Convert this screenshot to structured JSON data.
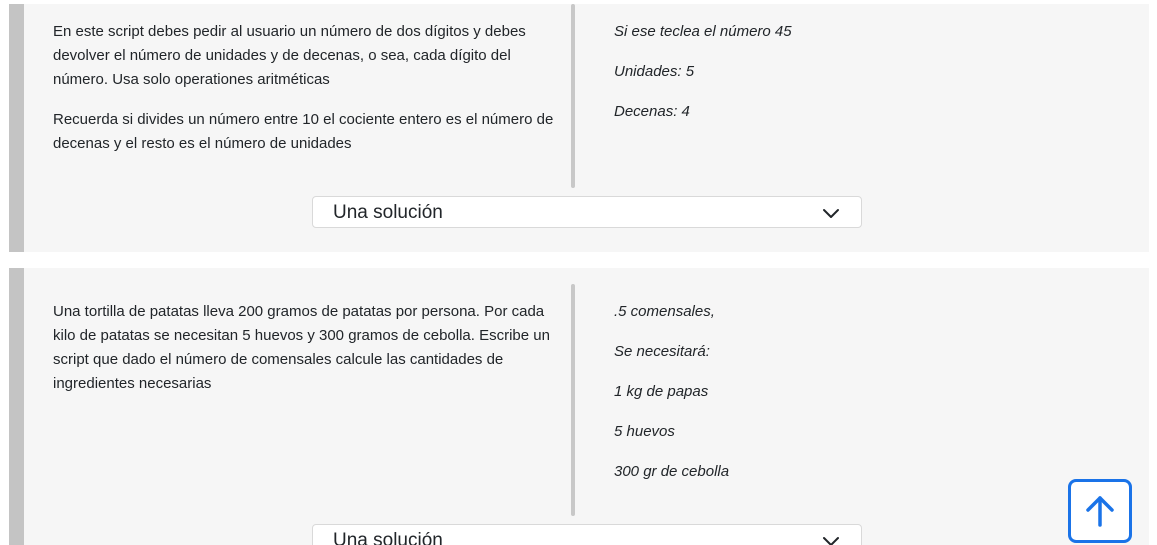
{
  "exercises": [
    {
      "statement": [
        "En este script debes pedir al usuario un número de dos dígitos y debes devolver el número de unidades y de decenas, o sea, cada dígito del número. Usa solo operationes aritméticas",
        "Recuerda si divides un número entre 10 el cociente entero es el número de decenas y el resto es el número de unidades"
      ],
      "example": [
        "Si ese teclea el número 45",
        "Unidades: 5",
        "Decenas: 4"
      ],
      "solution_label": "Una solución"
    },
    {
      "statement": [
        "Una tortilla de patatas lleva 200 gramos de patatas por persona. Por cada kilo de patatas se necesitan 5 huevos y 300 gramos de cebolla. Escribe un script que dado el número de comensales calcule las cantidades de ingredientes necesarias"
      ],
      "example": [
        ".5 comensales,",
        "Se necesitará:",
        "1 kg de papas",
        "5 huevos",
        "300 gr de cebolla"
      ],
      "solution_label": "Una solución"
    }
  ],
  "icons": {
    "accordion": "chevron-down-icon",
    "scroll_top": "arrow-up-icon"
  },
  "colors": {
    "card_background": "#f6f6f6",
    "card_border": "#c4c4c4",
    "accent": "#1a73e8"
  }
}
